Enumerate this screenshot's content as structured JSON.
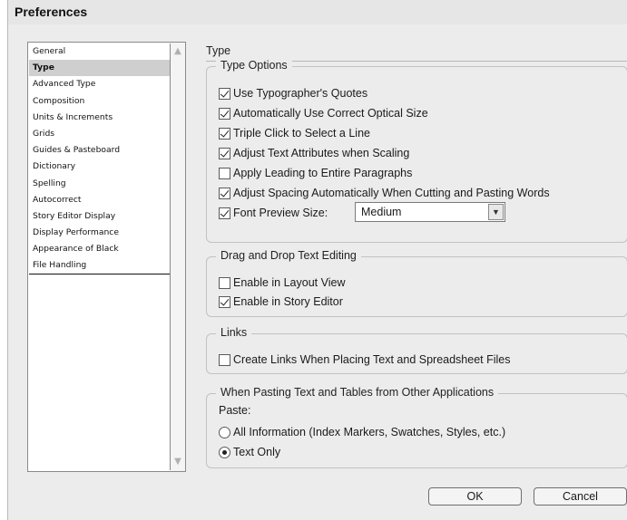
{
  "window": {
    "title": "Preferences"
  },
  "categories": [
    {
      "label": "General",
      "selected": false
    },
    {
      "label": "Type",
      "selected": true
    },
    {
      "label": "Advanced Type",
      "selected": false
    },
    {
      "label": "Composition",
      "selected": false
    },
    {
      "label": "Units & Increments",
      "selected": false
    },
    {
      "label": "Grids",
      "selected": false
    },
    {
      "label": "Guides & Pasteboard",
      "selected": false
    },
    {
      "label": "Dictionary",
      "selected": false
    },
    {
      "label": "Spelling",
      "selected": false
    },
    {
      "label": "Autocorrect",
      "selected": false
    },
    {
      "label": "Story Editor Display",
      "selected": false
    },
    {
      "label": "Display Performance",
      "selected": false
    },
    {
      "label": "Appearance of Black",
      "selected": false
    },
    {
      "label": "File Handling",
      "selected": false
    }
  ],
  "panel": {
    "title": "Type"
  },
  "type_options": {
    "legend": "Type Options",
    "items": [
      {
        "label": "Use Typographer's Quotes",
        "checked": true
      },
      {
        "label": "Automatically Use Correct Optical Size",
        "checked": true
      },
      {
        "label": "Triple Click to Select a Line",
        "checked": true
      },
      {
        "label": "Adjust Text Attributes when Scaling",
        "checked": true
      },
      {
        "label": "Apply Leading to Entire Paragraphs",
        "checked": false
      },
      {
        "label": "Adjust Spacing Automatically When Cutting and Pasting Words",
        "checked": true
      },
      {
        "label": "Font Preview Size:",
        "checked": true
      }
    ],
    "font_preview_size": "Medium"
  },
  "drag_drop": {
    "legend": "Drag and Drop Text Editing",
    "items": [
      {
        "label": "Enable in Layout View",
        "checked": false
      },
      {
        "label": "Enable in Story Editor",
        "checked": true
      }
    ]
  },
  "links": {
    "legend": "Links",
    "items": [
      {
        "label": "Create Links When Placing Text and Spreadsheet Files",
        "checked": false
      }
    ]
  },
  "pasting": {
    "legend": "When Pasting Text and Tables from Other Applications",
    "paste_label": "Paste:",
    "options": [
      {
        "label": "All Information (Index Markers, Swatches, Styles, etc.)",
        "checked": false
      },
      {
        "label": "Text Only",
        "checked": true
      }
    ]
  },
  "buttons": {
    "ok": "OK",
    "cancel": "Cancel"
  }
}
